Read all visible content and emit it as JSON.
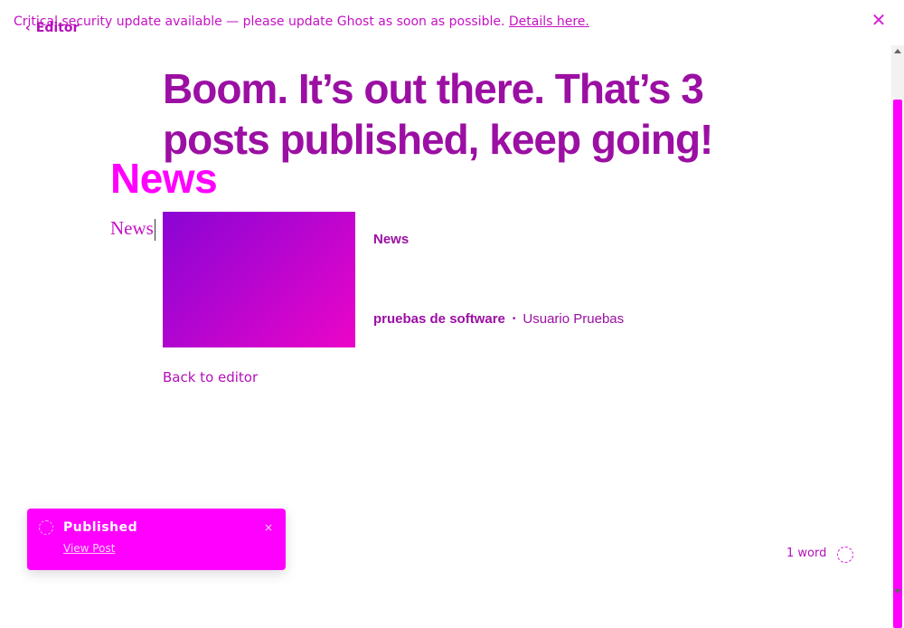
{
  "banner": {
    "message": "Critical security update available — please update Ghost as soon as possible.",
    "link": "Details here.",
    "close_icon": "close-icon"
  },
  "nav": {
    "back_label": "Editor",
    "back_icon": "chevron-left-icon"
  },
  "publish": {
    "headline": "Boom. It’s out there. That’s 3 posts published, keep going!",
    "post_title": "News",
    "editor_text": "News",
    "card": {
      "title": "News",
      "site": "pruebas de software",
      "separator": "•",
      "author": "Usuario Pruebas"
    },
    "back_to_editor": "Back to editor"
  },
  "toast": {
    "title": "Published",
    "link": "View Post",
    "close": "×",
    "icon": "loading-icon"
  },
  "footer": {
    "word_count": "1 word",
    "help_icon": "help-icon"
  },
  "colors": {
    "accent": "#ff00ff",
    "text": "#9b0fa3"
  }
}
